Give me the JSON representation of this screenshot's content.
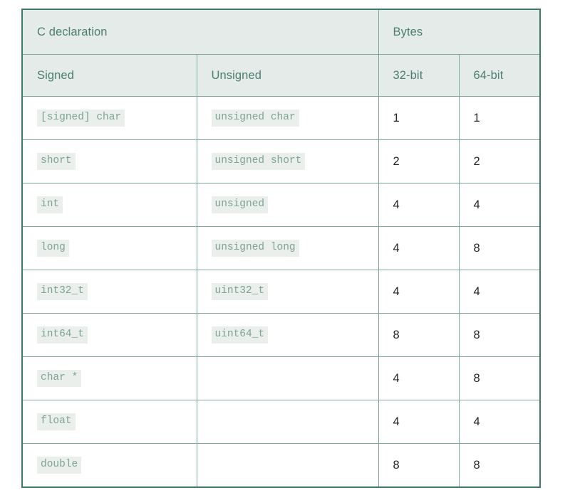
{
  "table": {
    "name": "c-data-type-sizes-table",
    "header": {
      "group_declaration": "C declaration",
      "group_bytes": "Bytes",
      "col_signed": "Signed",
      "col_unsigned": "Unsigned",
      "col_32bit": "32-bit",
      "col_64bit": "64-bit"
    },
    "columns": [
      "Signed",
      "Unsigned",
      "32-bit",
      "64-bit"
    ],
    "rows": [
      {
        "signed": "[signed] char",
        "unsigned": "unsigned char",
        "bytes_32": "1",
        "bytes_64": "1"
      },
      {
        "signed": "short",
        "unsigned": "unsigned short",
        "bytes_32": "2",
        "bytes_64": "2"
      },
      {
        "signed": "int",
        "unsigned": "unsigned",
        "bytes_32": "4",
        "bytes_64": "4"
      },
      {
        "signed": "long",
        "unsigned": "unsigned long",
        "bytes_32": "4",
        "bytes_64": "8"
      },
      {
        "signed": "int32_t",
        "unsigned": "uint32_t",
        "bytes_32": "4",
        "bytes_64": "4"
      },
      {
        "signed": "int64_t",
        "unsigned": "uint64_t",
        "bytes_32": "8",
        "bytes_64": "8"
      },
      {
        "signed": "char *",
        "unsigned": "",
        "bytes_32": "4",
        "bytes_64": "8"
      },
      {
        "signed": "float",
        "unsigned": "",
        "bytes_32": "4",
        "bytes_64": "4"
      },
      {
        "signed": "double",
        "unsigned": "",
        "bytes_32": "8",
        "bytes_64": "8"
      }
    ]
  },
  "colors": {
    "page_background": "#ffffff",
    "table_outer_border": "#3f7a68",
    "cell_border": "#7fa89b",
    "header_background": "#e5ebe8",
    "header_text": "#4c7e71",
    "code_text": "#7fa296",
    "code_background": "#eaefec",
    "number_text": "#232629"
  }
}
